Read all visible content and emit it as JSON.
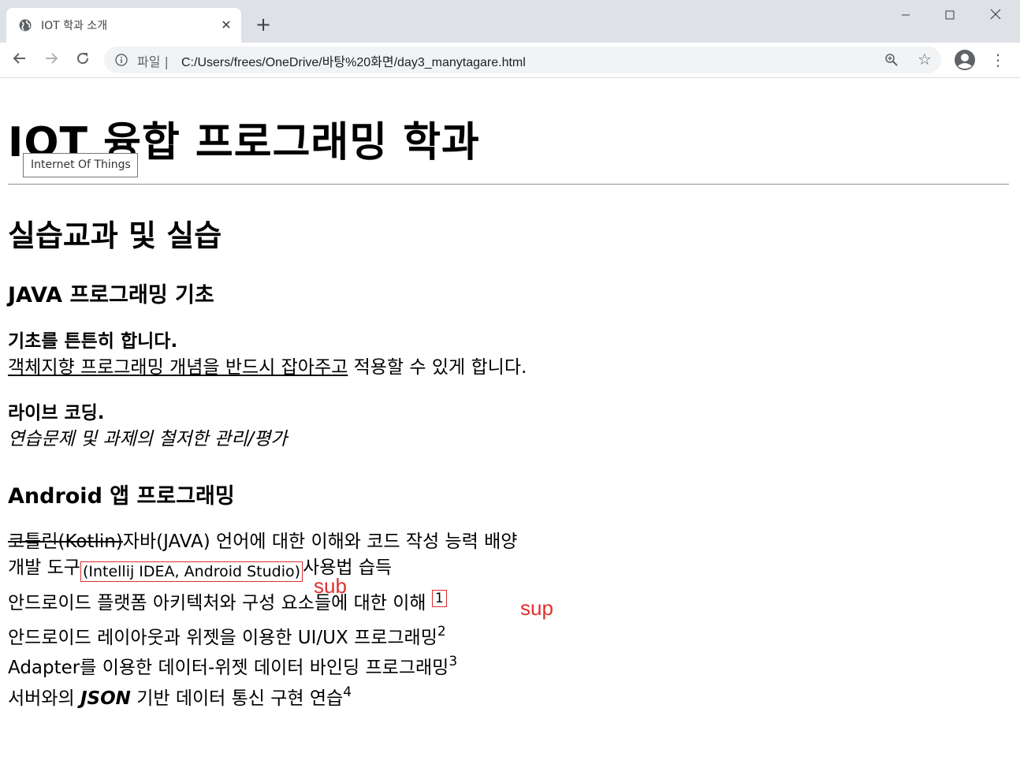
{
  "browser": {
    "tab_title": "IOT 학과 소개",
    "new_tab_symbol": "+",
    "omnibox": {
      "scheme_label": "파일",
      "separator": "|",
      "url": "C:/Users/frees/OneDrive/바탕%20화면/day3_manytagare.html"
    }
  },
  "page": {
    "title": "IOT 융합 프로그래밍 학과",
    "abbr_tooltip": "Internet Of Things",
    "section_title": "실습교과 및 실습",
    "java": {
      "heading": "JAVA 프로그래밍 기초",
      "strong1": "기초를 튼튼히 합니다.",
      "underlined": "객체지향 프로그래밍 개념을 반드시 잡아주고",
      "after_underline": " 적용할 수 있게 합니다.",
      "strong2": "라이브 코딩.",
      "italic": "연습문제 및 과제의 철저한 관리/평가"
    },
    "android": {
      "heading": "Android 앱 프로그래밍",
      "struck": "코틀린(Kotlin)",
      "line1_rest": "자바(JAVA) 언어에 대한 이해와 코드 작성 능력 배양",
      "line2_start": "개발 도구",
      "line2_sub": "(Intellij IDEA, Android Studio)",
      "line2_end": "사용법 습득",
      "line3": "안드로이드 플랫폼 아키텍처와 구성 요소들에 대한 이해 ",
      "line3_sup": "1",
      "line4": "안드로이드 레이아웃과 위젯을 이용한 UI/UX 프로그래밍",
      "line4_sup": "2",
      "line5": "Adapter를 이용한 데이터-위젯 데이터 바인딩 프로그래밍",
      "line5_sup": "3",
      "line6_start": "서버와의 ",
      "line6_em": "JSON",
      "line6_end": " 기반 데이터 통신 구현 연습",
      "line6_sup": "4"
    },
    "annotations": {
      "sub_note": "sub",
      "sup_note": "sup"
    }
  }
}
